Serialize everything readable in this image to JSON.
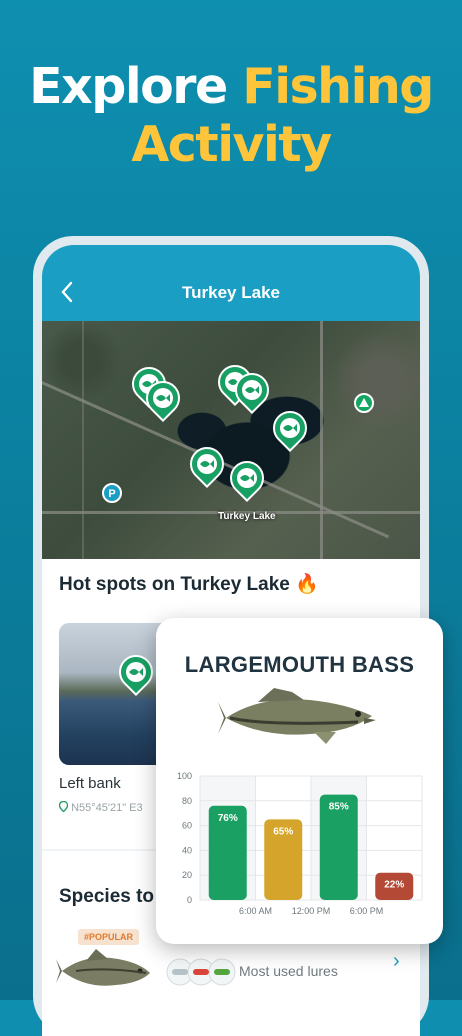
{
  "headline": {
    "line1_white": "Explore ",
    "line1_yellow": "Fishing",
    "line2_yellow": "Activity"
  },
  "colors": {
    "accent": "#1a9ec3",
    "headline_yellow": "#ffc53a",
    "pin_green": "#18a064"
  },
  "nav": {
    "title": "Turkey Lake",
    "back_icon": "chevron-left-icon"
  },
  "map": {
    "lake_label": "Turkey Lake",
    "parking_label": "P"
  },
  "hot_spots": {
    "title": "Hot spots on Turkey Lake 🔥",
    "items": [
      {
        "name": "Left bank",
        "coordinates": "N55°45'21\" E3"
      }
    ]
  },
  "species": {
    "title": "Species to",
    "badge": "#POPULAR",
    "lures_label": "Most used lures"
  },
  "fish_card": {
    "name": "LARGEMOUTH BASS"
  },
  "chart_data": {
    "type": "bar",
    "categories": [
      "",
      "6:00 AM",
      "12:00 PM",
      "6:00 PM"
    ],
    "values": [
      76,
      65,
      85,
      22
    ],
    "data_labels": [
      "76%",
      "65%",
      "85%",
      "22%"
    ],
    "x_tick_labels": [
      "6:00 AM",
      "12:00 PM",
      "6:00 PM"
    ],
    "y_ticks": [
      "0",
      "20",
      "40",
      "60",
      "80",
      "100"
    ],
    "ylim": [
      0,
      100
    ],
    "bar_colors": [
      "#1aa062",
      "#d4a52a",
      "#1aa062",
      "#b44a35"
    ],
    "title": "",
    "xlabel": "",
    "ylabel": "",
    "grid": true
  }
}
